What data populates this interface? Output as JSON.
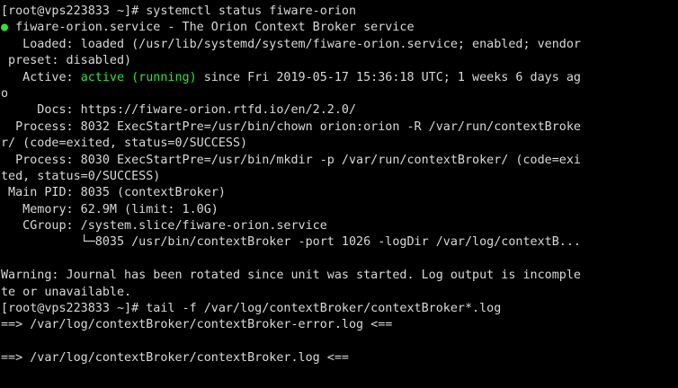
{
  "colors": {
    "background": "#000000",
    "foreground": "#d9d9d9",
    "active": "#2fe23a"
  },
  "lines": {
    "l1": "[root@vps223833 ~]# systemctl status fiware-orion",
    "l2_dot": "●",
    "l2_rest": " fiware-orion.service - The Orion Context Broker service",
    "l3": "   Loaded: loaded (/usr/lib/systemd/system/fiware-orion.service; enabled; vendor",
    "l4": " preset: disabled)",
    "l5_a": "   Active: ",
    "l5_b": "active (running)",
    "l5_c": " since Fri 2019-05-17 15:36:18 UTC; 1 weeks 6 days ag",
    "l6": "o",
    "l7": "     Docs: https://fiware-orion.rtfd.io/en/2.2.0/",
    "l8": "  Process: 8032 ExecStartPre=/usr/bin/chown orion:orion -R /var/run/contextBroke",
    "l9": "r/ (code=exited, status=0/SUCCESS)",
    "l10": "  Process: 8030 ExecStartPre=/usr/bin/mkdir -p /var/run/contextBroker/ (code=exi",
    "l11": "ted, status=0/SUCCESS)",
    "l12": " Main PID: 8035 (contextBroker)",
    "l13": "   Memory: 62.9M (limit: 1.0G)",
    "l14": "   CGroup: /system.slice/fiware-orion.service",
    "l15": "           └─8035 /usr/bin/contextBroker -port 1026 -logDir /var/log/contextB...",
    "l16": "",
    "l17": "Warning: Journal has been rotated since unit was started. Log output is incomple",
    "l18": "te or unavailable.",
    "l19": "[root@vps223833 ~]# tail -f /var/log/contextBroker/contextBroker*.log",
    "l20": "==> /var/log/contextBroker/contextBroker-error.log <==",
    "l21": "",
    "l22": "==> /var/log/contextBroker/contextBroker.log <=="
  }
}
